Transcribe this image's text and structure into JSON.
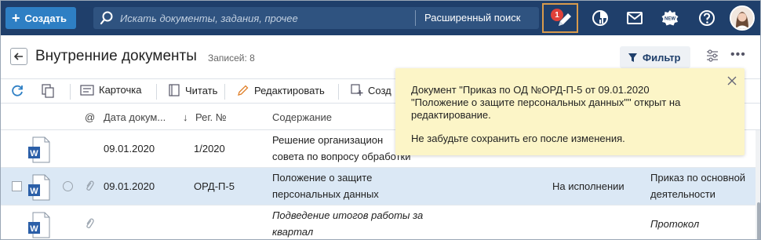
{
  "topbar": {
    "create_label": "Создать",
    "search_placeholder": "Искать документы, задания, прочее",
    "advanced_search_label": "Расширенный поиск",
    "notification_count": "1",
    "new_badge": "NEW",
    "accent": "#1f3f6b"
  },
  "header": {
    "title": "Внутренние документы",
    "count_label": "Записей: 8",
    "filter_label": "Фильтр"
  },
  "toolbar": {
    "card_label": "Карточка",
    "read_label": "Читать",
    "edit_label": "Редактировать",
    "create_label": "Созд"
  },
  "columns": {
    "at": "@",
    "date": "Дата докум...",
    "reg": "Рег. №",
    "content": "Содержание"
  },
  "rows": [
    {
      "date": "09.01.2020",
      "reg": "1/2020",
      "content_1": "Решение организацион",
      "content_2": "совета по вопросу обработки",
      "status": "",
      "type_1": "",
      "type_2": ""
    },
    {
      "date": "09.01.2020",
      "reg": "ОРД-П-5",
      "content_1": "Положение о защите",
      "content_2": "персональных данных",
      "status": "На исполнении",
      "type_1": "Приказ по основной",
      "type_2": "деятельности"
    },
    {
      "date": "",
      "reg": "",
      "content_1": "Подведение итогов работы за",
      "content_2": "квартал",
      "status": "",
      "type_1": "Протокол",
      "type_2": ""
    }
  ],
  "notification": {
    "message": "Документ \"Приказ по ОД №ОРД-П-5 от 09.01.2020 \"Положение о защите персональных данных\"\" открыт на редактирование.",
    "hint": "Не забудьте сохранить его после изменения."
  }
}
